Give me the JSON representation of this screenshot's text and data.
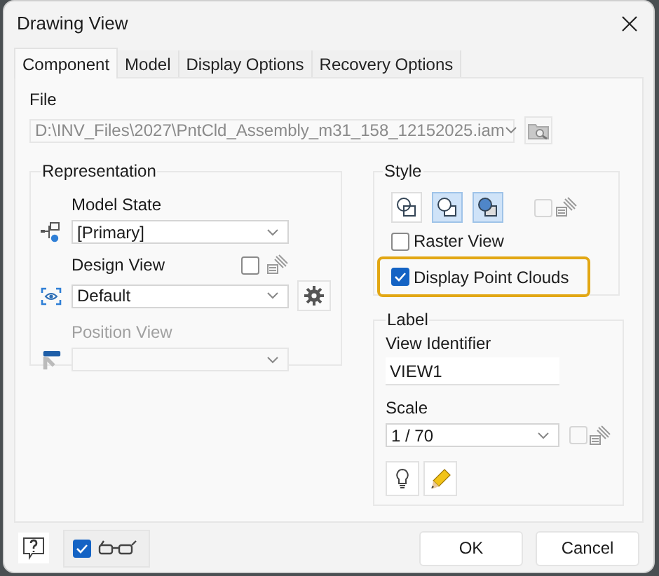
{
  "window": {
    "title": "Drawing View"
  },
  "tabs": [
    {
      "label": "Component",
      "selected": true
    },
    {
      "label": "Model",
      "selected": false
    },
    {
      "label": "Display Options",
      "selected": false
    },
    {
      "label": "Recovery Options",
      "selected": false
    }
  ],
  "file": {
    "label": "File",
    "value": "D:\\INV_Files\\2027\\PntCld_Assembly_m31_158_12152025.iam",
    "disabled": true
  },
  "representation": {
    "title": "Representation",
    "fields": [
      {
        "kind": "model_state",
        "label": "Model State",
        "value": "[Primary]",
        "disabled": false
      },
      {
        "kind": "design_view",
        "label": "Design View",
        "value": "Default",
        "disabled": false,
        "checked": false
      },
      {
        "kind": "position_view",
        "label": "Position View",
        "disabled": true
      }
    ]
  },
  "style": {
    "title": "Style",
    "buttons": [
      {
        "kind": "hidden_lines",
        "selected": false
      },
      {
        "kind": "hidden_lines_removed",
        "selected": true
      },
      {
        "kind": "shaded",
        "selected": true
      }
    ],
    "linked_checked": false,
    "options": [
      {
        "label": "Raster View",
        "checked": false,
        "highlighted": false
      },
      {
        "label": "Display Point Clouds",
        "checked": true,
        "highlighted": true
      }
    ]
  },
  "label": {
    "title": "Label",
    "view_identifier": {
      "label": "View Identifier",
      "value": "VIEW1"
    },
    "scale": {
      "label": "Scale",
      "value": "1 / 70",
      "linked_checked": false
    }
  },
  "footer": {
    "preview_checked": true,
    "buttons": [
      "OK",
      "Cancel"
    ]
  }
}
